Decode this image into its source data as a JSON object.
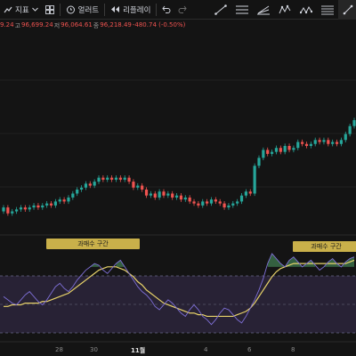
{
  "toolbar": {
    "indicators_label": "지표",
    "alert_label": "얼러트",
    "replay_label": "리플레이"
  },
  "icons": [
    "indicator-icon",
    "chevron-down-icon",
    "layout-grid-icon",
    "alarm-clock-icon",
    "replay-icon",
    "undo-icon",
    "redo-icon",
    "trend-line-icon",
    "horizontal-lines-icon",
    "ray-icon",
    "zigzag-icon",
    "pattern-icon",
    "fib-icon",
    "text-line-icon"
  ],
  "ohlc": {
    "o_value": "9.24",
    "h_label": "고",
    "h_value": "96,699.24",
    "l_label": "저",
    "l_value": "96,064.61",
    "c_label": "종",
    "c_value": "96,218.49",
    "change": "-480.74 (-0.50%)"
  },
  "colors": {
    "up": "#26a69a",
    "down": "#ef5350",
    "rsi": "#7e6fd6",
    "ma": "#e8d36a",
    "badge": "#c9b04a"
  },
  "badges": [
    {
      "label": "과매수 구간"
    },
    {
      "label": "과매수 구간"
    }
  ],
  "dates": [
    "28",
    "30",
    "11월",
    "4",
    "6",
    "8"
  ],
  "chart_data": {
    "type": "candlestick",
    "candles": [
      {
        "o": 40,
        "c": 42
      },
      {
        "o": 42,
        "c": 39
      },
      {
        "o": 39,
        "c": 40
      },
      {
        "o": 40,
        "c": 41
      },
      {
        "o": 41,
        "c": 42
      },
      {
        "o": 42,
        "c": 41
      },
      {
        "o": 41,
        "c": 42
      },
      {
        "o": 42,
        "c": 43
      },
      {
        "o": 43,
        "c": 42
      },
      {
        "o": 42,
        "c": 43
      },
      {
        "o": 43,
        "c": 44
      },
      {
        "o": 44,
        "c": 43
      },
      {
        "o": 43,
        "c": 45
      },
      {
        "o": 45,
        "c": 46
      },
      {
        "o": 46,
        "c": 45
      },
      {
        "o": 45,
        "c": 47
      },
      {
        "o": 47,
        "c": 49
      },
      {
        "o": 49,
        "c": 51
      },
      {
        "o": 51,
        "c": 52
      },
      {
        "o": 52,
        "c": 54
      },
      {
        "o": 54,
        "c": 53
      },
      {
        "o": 53,
        "c": 55
      },
      {
        "o": 55,
        "c": 57
      },
      {
        "o": 57,
        "c": 56
      },
      {
        "o": 56,
        "c": 57
      },
      {
        "o": 57,
        "c": 56
      },
      {
        "o": 56,
        "c": 57
      },
      {
        "o": 57,
        "c": 56
      },
      {
        "o": 56,
        "c": 57
      },
      {
        "o": 57,
        "c": 55
      },
      {
        "o": 55,
        "c": 52
      },
      {
        "o": 52,
        "c": 53
      },
      {
        "o": 53,
        "c": 51
      },
      {
        "o": 51,
        "c": 48
      },
      {
        "o": 48,
        "c": 49
      },
      {
        "o": 49,
        "c": 47
      },
      {
        "o": 47,
        "c": 50
      },
      {
        "o": 50,
        "c": 48
      },
      {
        "o": 48,
        "c": 49
      },
      {
        "o": 49,
        "c": 47
      },
      {
        "o": 47,
        "c": 48
      },
      {
        "o": 48,
        "c": 46
      },
      {
        "o": 46,
        "c": 47
      },
      {
        "o": 47,
        "c": 45
      },
      {
        "o": 45,
        "c": 44
      },
      {
        "o": 44,
        "c": 43
      },
      {
        "o": 43,
        "c": 45
      },
      {
        "o": 45,
        "c": 44
      },
      {
        "o": 44,
        "c": 46
      },
      {
        "o": 46,
        "c": 45
      },
      {
        "o": 45,
        "c": 44
      },
      {
        "o": 44,
        "c": 42
      },
      {
        "o": 42,
        "c": 43
      },
      {
        "o": 43,
        "c": 44
      },
      {
        "o": 44,
        "c": 45
      },
      {
        "o": 45,
        "c": 48
      },
      {
        "o": 48,
        "c": 50
      },
      {
        "o": 50,
        "c": 49
      },
      {
        "o": 49,
        "c": 63
      },
      {
        "o": 63,
        "c": 67
      },
      {
        "o": 67,
        "c": 71
      },
      {
        "o": 71,
        "c": 69
      },
      {
        "o": 69,
        "c": 70
      },
      {
        "o": 70,
        "c": 72
      },
      {
        "o": 72,
        "c": 70
      },
      {
        "o": 70,
        "c": 73
      },
      {
        "o": 73,
        "c": 71
      },
      {
        "o": 71,
        "c": 72
      },
      {
        "o": 72,
        "c": 75
      },
      {
        "o": 75,
        "c": 74
      },
      {
        "o": 74,
        "c": 73
      },
      {
        "o": 73,
        "c": 74
      },
      {
        "o": 74,
        "c": 76
      },
      {
        "o": 76,
        "c": 75
      },
      {
        "o": 75,
        "c": 76
      },
      {
        "o": 76,
        "c": 74
      },
      {
        "o": 74,
        "c": 75
      },
      {
        "o": 75,
        "c": 74
      },
      {
        "o": 74,
        "c": 76
      },
      {
        "o": 76,
        "c": 79
      },
      {
        "o": 79,
        "c": 83
      },
      {
        "o": 83,
        "c": 86
      }
    ],
    "rsi": [
      52,
      50,
      48,
      47,
      50,
      53,
      55,
      52,
      49,
      47,
      50,
      54,
      58,
      60,
      57,
      55,
      58,
      62,
      65,
      68,
      70,
      72,
      71,
      68,
      66,
      69,
      72,
      74,
      70,
      66,
      62,
      58,
      55,
      53,
      50,
      46,
      44,
      47,
      50,
      48,
      45,
      42,
      40,
      44,
      47,
      44,
      40,
      38,
      35,
      38,
      42,
      45,
      44,
      41,
      38,
      36,
      40,
      45,
      50,
      56,
      63,
      72,
      78,
      75,
      72,
      70,
      74,
      76,
      73,
      70,
      72,
      74,
      71,
      68,
      70,
      73,
      75,
      72,
      70,
      73,
      75,
      76
    ],
    "ma": [
      46,
      46,
      47,
      47,
      47,
      48,
      48,
      48,
      48,
      49,
      49,
      50,
      51,
      52,
      53,
      54,
      56,
      58,
      60,
      62,
      64,
      66,
      68,
      69,
      70,
      70,
      70,
      69,
      68,
      66,
      64,
      61,
      59,
      56,
      54,
      52,
      50,
      48,
      47,
      46,
      45,
      44,
      43,
      42,
      42,
      41,
      41,
      40,
      40,
      40,
      40,
      40,
      40,
      40,
      41,
      42,
      43,
      45,
      48,
      52,
      56,
      60,
      64,
      67,
      69,
      70,
      71,
      72,
      72,
      72,
      72,
      72,
      72,
      72,
      72,
      72,
      72,
      72,
      72,
      72,
      73,
      74
    ]
  }
}
